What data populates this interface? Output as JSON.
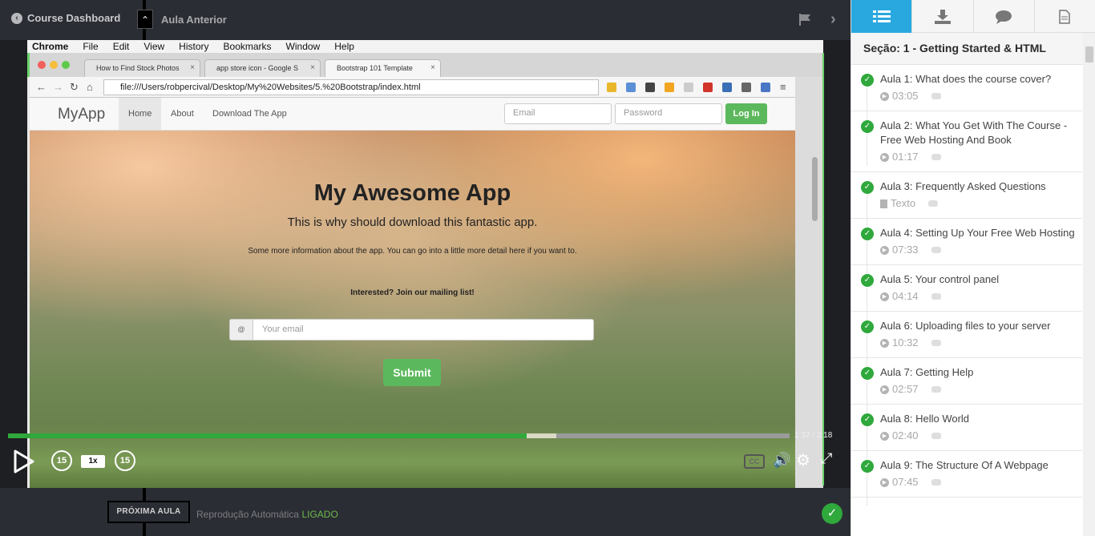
{
  "topbar": {
    "dashboard_label": "Course Dashboard",
    "previous_label": "Aula Anterior"
  },
  "video": {
    "browser": {
      "menu": [
        "Chrome",
        "File",
        "Edit",
        "View",
        "History",
        "Bookmarks",
        "Window",
        "Help"
      ],
      "tabs": [
        "How to Find Stock Photos",
        "app store icon - Google S",
        "Bootstrap 101 Template"
      ],
      "url": "file:///Users/robpercival/Desktop/My%20Websites/5.%20Bootstrap/index.html"
    },
    "site": {
      "brand": "MyApp",
      "nav": [
        "Home",
        "About",
        "Download The App"
      ],
      "email_placeholder": "Email",
      "password_placeholder": "Password",
      "login_label": "Log In",
      "hero_title": "My Awesome App",
      "hero_subtitle": "This is why should download this fantastic app.",
      "hero_info": "Some more information about the app. You can go into a little more detail here if you want to.",
      "join_text": "Interested? Join our mailing list!",
      "email_field_placeholder": "Your email",
      "submit_label": "Submit"
    },
    "player": {
      "current_time": "1:32",
      "separator": "/",
      "duration": "2:18",
      "played_fraction": 0.664,
      "buffered_fraction": 0.702,
      "rewind_label": "15",
      "forward_label": "15",
      "speed_label": "1x"
    }
  },
  "bottombar": {
    "next_label": "PRÓXIMA AULA",
    "autoplay_label": "Reprodução Automática",
    "autoplay_state": "LIGADO"
  },
  "sidebar": {
    "tabs": [
      "list-icon",
      "download-icon",
      "chat-icon",
      "document-icon"
    ],
    "section_title": "Seção: 1 - Getting Started & HTML",
    "lessons": [
      {
        "title": "Aula 1: What does the course cover?",
        "meta": "03:05",
        "type": "video"
      },
      {
        "title": "Aula 2: What You Get With The Course - Free Web Hosting And Book",
        "meta": "01:17",
        "type": "video"
      },
      {
        "title": "Aula 3: Frequently Asked Questions",
        "meta": "Texto",
        "type": "text"
      },
      {
        "title": "Aula 4: Setting Up Your Free Web Hosting",
        "meta": "07:33",
        "type": "video"
      },
      {
        "title": "Aula 5: Your control panel",
        "meta": "04:14",
        "type": "video"
      },
      {
        "title": "Aula 6: Uploading files to your server",
        "meta": "10:32",
        "type": "video"
      },
      {
        "title": "Aula 7: Getting Help",
        "meta": "02:57",
        "type": "video"
      },
      {
        "title": "Aula 8: Hello World",
        "meta": "02:40",
        "type": "video"
      },
      {
        "title": "Aula 9: The Structure Of A Webpage",
        "meta": "07:45",
        "type": "video"
      }
    ]
  },
  "colors": {
    "accent_blue": "#29a8e0",
    "success_green": "#2fa83c",
    "bar_bg": "#2b2d34"
  }
}
